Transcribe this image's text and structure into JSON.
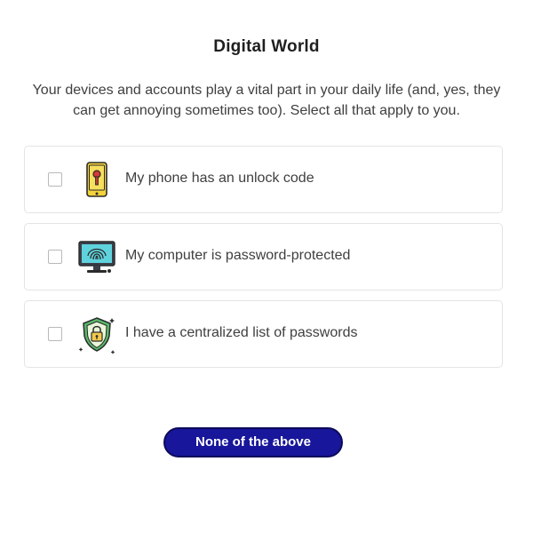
{
  "page": {
    "title": "Digital World",
    "subtitle": "Your devices and accounts play a vital part in your daily life (and, yes, they can get annoying sometimes too). Select all that apply to you."
  },
  "options": [
    {
      "label": "My phone has an unlock code",
      "icon": "phone-lock-icon",
      "checked": false
    },
    {
      "label": "My computer is password-protected",
      "icon": "computer-fingerprint-icon",
      "checked": false
    },
    {
      "label": "I have a centralized list of passwords",
      "icon": "shield-lock-icon",
      "checked": false
    }
  ],
  "actions": {
    "none_label": "None of the above"
  },
  "colors": {
    "button_bg": "#18169a",
    "card_border": "#e4e4e4"
  }
}
